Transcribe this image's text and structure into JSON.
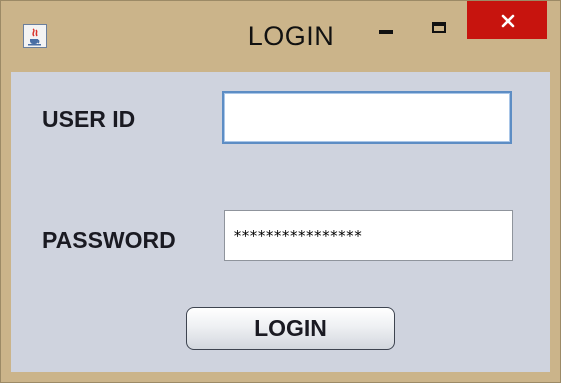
{
  "window": {
    "title": "LOGIN",
    "app_icon": "java-cup-icon",
    "controls": {
      "minimize": "minimize-icon",
      "maximize": "maximize-icon",
      "close": "close-icon",
      "close_color": "#c7140e"
    },
    "frame_color": "#cbb48a",
    "content_color": "#cfd3de"
  },
  "form": {
    "user_id_label": "USER ID",
    "user_id_value": "",
    "password_label": "PASSWORD",
    "password_value": "****************",
    "login_button_label": "LOGIN"
  }
}
